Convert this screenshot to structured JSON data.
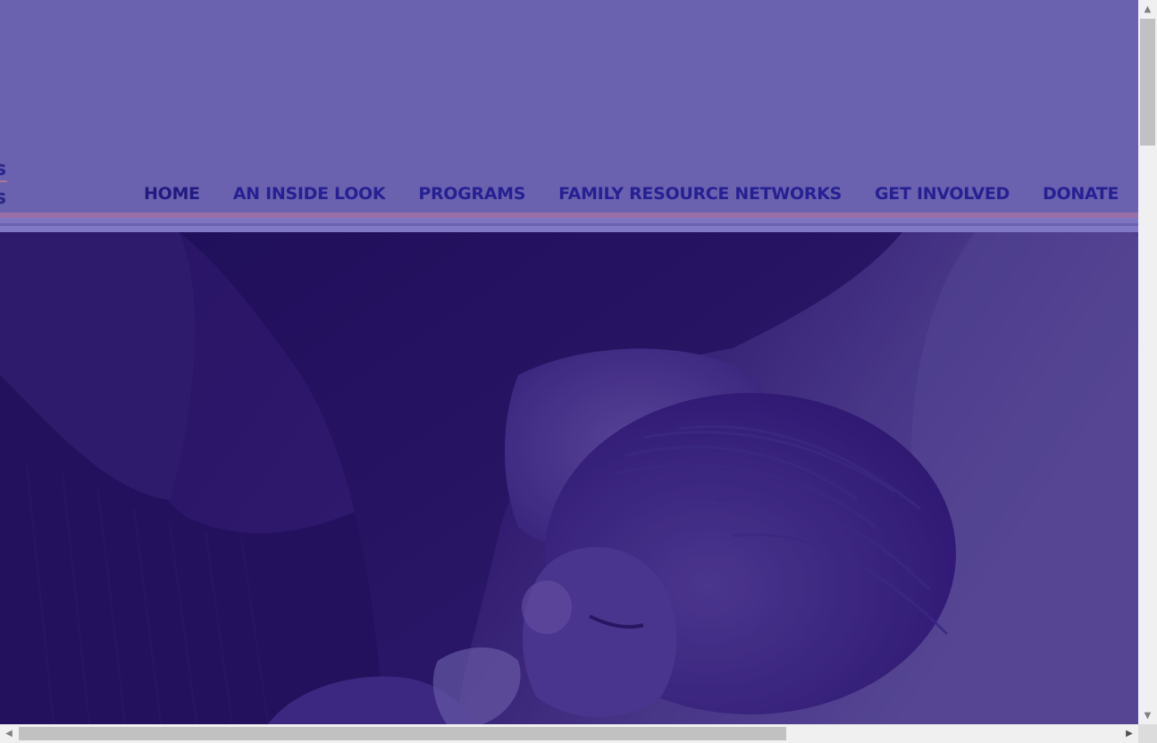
{
  "header": {
    "logo_fragment": {
      "line1": "s",
      "line2": "s"
    }
  },
  "nav": {
    "items": [
      {
        "label": "HOME"
      },
      {
        "label": "AN INSIDE LOOK"
      },
      {
        "label": "PROGRAMS"
      },
      {
        "label": "FAMILY RESOURCE NETWORKS"
      },
      {
        "label": "GET INVOLVED"
      },
      {
        "label": "DONATE"
      }
    ]
  },
  "hero": {
    "image_icon": "mother-kissing-baby-photo"
  },
  "colors": {
    "header_bg": "#6a62ae",
    "nav_text": "#272093",
    "accent_band": "#9a6ea7",
    "light_band": "#8179c6",
    "hero_tint": "#3a2478"
  },
  "scrollbars": {
    "vertical_position": 0.0,
    "horizontal_position": 0.0,
    "horizontal_visible_fraction": 0.69
  }
}
